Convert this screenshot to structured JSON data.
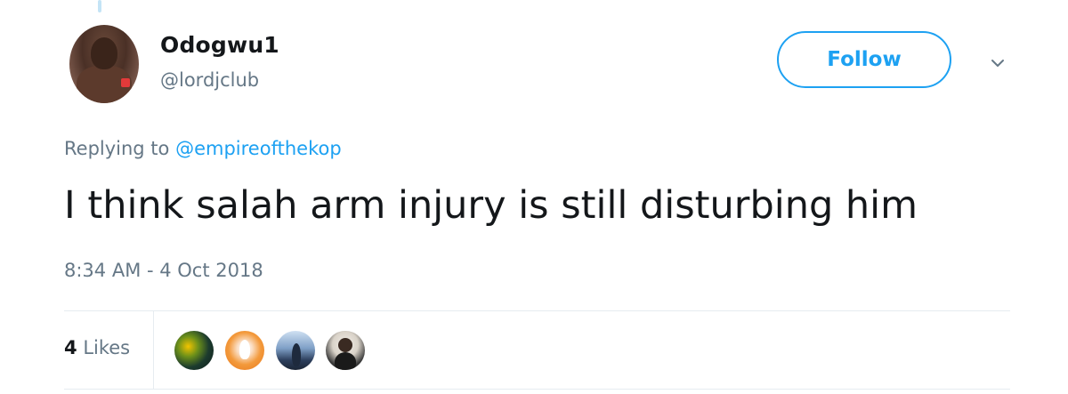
{
  "tweet": {
    "author": {
      "display_name": "Odogwu1",
      "handle": "@lordjclub"
    },
    "follow_label": "Follow",
    "replying_prefix": "Replying to",
    "replying_to": "@empireofthekop",
    "text": "I think salah arm injury is still disturbing him",
    "timestamp": "8:34 AM - 4 Oct 2018",
    "likes": {
      "count": "4",
      "label": "Likes"
    }
  },
  "colors": {
    "accent": "#1da1f2",
    "secondary_text": "#657786",
    "primary_text": "#14171a",
    "divider": "#e6ecf0"
  },
  "icons": {
    "more_menu": "chevron-down-icon"
  }
}
